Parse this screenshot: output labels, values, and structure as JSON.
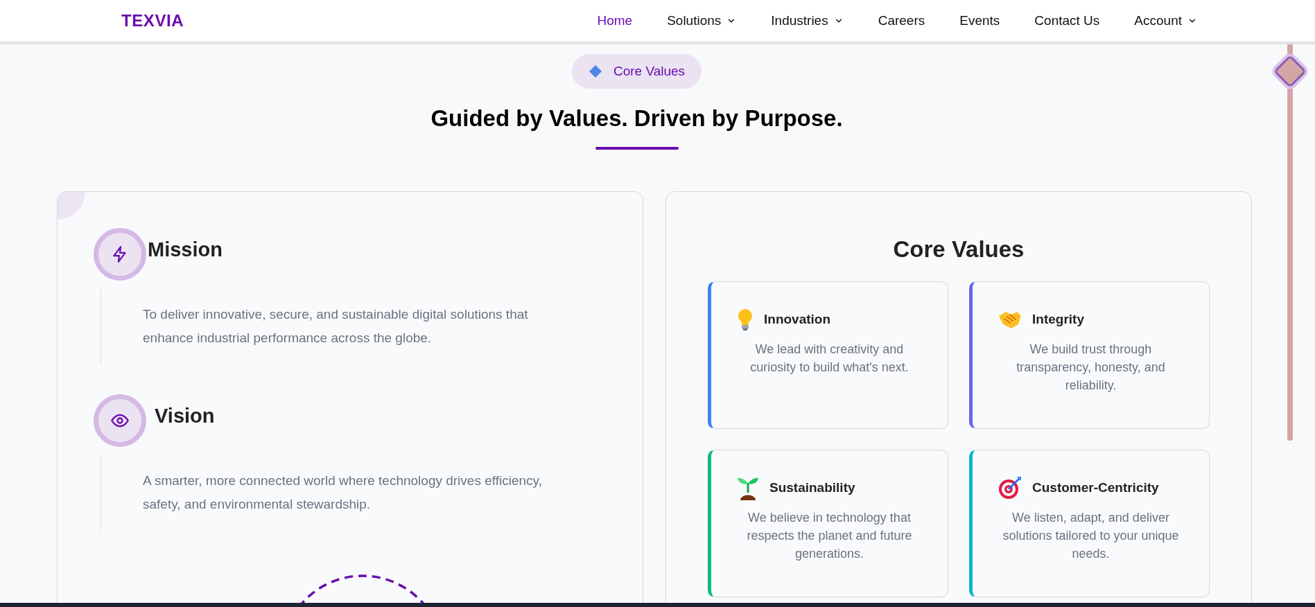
{
  "header": {
    "logo": "TEXVIA",
    "nav": [
      {
        "label": "Home",
        "selected": true,
        "dropdown": false
      },
      {
        "label": "Solutions",
        "selected": false,
        "dropdown": true
      },
      {
        "label": "Industries",
        "selected": false,
        "dropdown": true
      },
      {
        "label": "Careers",
        "selected": false,
        "dropdown": false
      },
      {
        "label": "Events",
        "selected": false,
        "dropdown": false
      },
      {
        "label": "Contact Us",
        "selected": false,
        "dropdown": false
      },
      {
        "label": "Account",
        "selected": false,
        "dropdown": true
      }
    ]
  },
  "section": {
    "badge": "Core Values",
    "heading": "Guided by Values. Driven by Purpose.",
    "statements": [
      {
        "kind": "mission",
        "title": "Mission",
        "text": "To deliver innovative, secure, and sustainable digital solutions that enhance industrial performance across the globe."
      },
      {
        "kind": "vision",
        "title": "Vision",
        "text": "A smarter, more connected world where technology drives efficiency, safety, and environmental stewardship."
      }
    ],
    "core_values": {
      "title": "Core Values",
      "items": [
        {
          "kind": "bulb",
          "title": "Innovation",
          "text": "We lead with creativity and curiosity to build what's next.",
          "color": "#3b82f6"
        },
        {
          "kind": "handshake",
          "title": "Integrity",
          "text": "We build trust through transparency, honesty, and reliability.",
          "color": "#6366f1"
        },
        {
          "kind": "sprout",
          "title": "Sustainability",
          "text": "We believe in technology that respects the planet and future generations.",
          "color": "#10b981"
        },
        {
          "kind": "target",
          "title": "Customer-Centricity",
          "text": "We listen, adapt, and deliver solutions tailored to your unique needs.",
          "color": "#06b6d4"
        }
      ]
    }
  }
}
